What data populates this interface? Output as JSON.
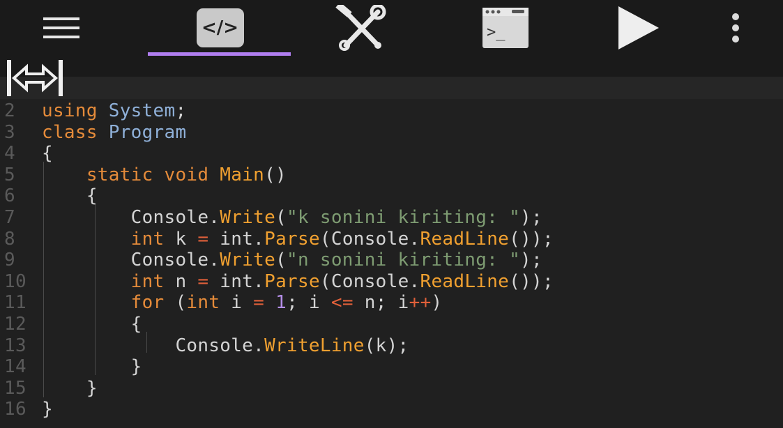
{
  "toolbar": {
    "menu_icon": "hamburger-menu-icon",
    "code_tab_label": "</>",
    "tools_icon": "wrench-hammer-icon",
    "terminal_icon": "terminal-icon",
    "terminal_prompt": ">_",
    "run_icon": "play-icon",
    "more_icon": "more-vertical-icon"
  },
  "editor": {
    "resize_icon": "resize-horizontal-icon",
    "lines": [
      {
        "n": "2",
        "code": [
          {
            "t": "using ",
            "c": "kw"
          },
          {
            "t": "System",
            "c": "ty"
          },
          {
            "t": ";",
            "c": ""
          }
        ]
      },
      {
        "n": "3",
        "code": [
          {
            "t": "class ",
            "c": "kw"
          },
          {
            "t": "Program",
            "c": "ty"
          }
        ]
      },
      {
        "n": "4",
        "code": [
          {
            "t": "{",
            "c": ""
          }
        ]
      },
      {
        "n": "5",
        "code": [
          {
            "t": "    static void ",
            "c": "kw"
          },
          {
            "t": "Main",
            "c": "fn"
          },
          {
            "t": "()",
            "c": ""
          }
        ]
      },
      {
        "n": "6",
        "code": [
          {
            "t": "    {",
            "c": ""
          }
        ]
      },
      {
        "n": "7",
        "code": [
          {
            "t": "        Console.",
            "c": ""
          },
          {
            "t": "Write",
            "c": "fn"
          },
          {
            "t": "(",
            "c": ""
          },
          {
            "t": "\"k sonini kiriting: \"",
            "c": "str"
          },
          {
            "t": ");",
            "c": ""
          }
        ]
      },
      {
        "n": "8",
        "code": [
          {
            "t": "        int ",
            "c": "kw"
          },
          {
            "t": "k ",
            "c": ""
          },
          {
            "t": "=",
            "c": "op"
          },
          {
            "t": " int.",
            "c": ""
          },
          {
            "t": "Parse",
            "c": "fn"
          },
          {
            "t": "(Console.",
            "c": ""
          },
          {
            "t": "ReadLine",
            "c": "fn"
          },
          {
            "t": "());",
            "c": ""
          }
        ]
      },
      {
        "n": "9",
        "code": [
          {
            "t": "        Console.",
            "c": ""
          },
          {
            "t": "Write",
            "c": "fn"
          },
          {
            "t": "(",
            "c": ""
          },
          {
            "t": "\"n sonini kiriting: \"",
            "c": "str"
          },
          {
            "t": ");",
            "c": ""
          }
        ]
      },
      {
        "n": "10",
        "code": [
          {
            "t": "        int ",
            "c": "kw"
          },
          {
            "t": "n ",
            "c": ""
          },
          {
            "t": "=",
            "c": "op"
          },
          {
            "t": " int.",
            "c": ""
          },
          {
            "t": "Parse",
            "c": "fn"
          },
          {
            "t": "(Console.",
            "c": ""
          },
          {
            "t": "ReadLine",
            "c": "fn"
          },
          {
            "t": "());",
            "c": ""
          }
        ]
      },
      {
        "n": "11",
        "code": [
          {
            "t": "        for ",
            "c": "kw"
          },
          {
            "t": "(",
            "c": ""
          },
          {
            "t": "int ",
            "c": "kw"
          },
          {
            "t": "i ",
            "c": ""
          },
          {
            "t": "=",
            "c": "op"
          },
          {
            "t": " ",
            "c": ""
          },
          {
            "t": "1",
            "c": "num"
          },
          {
            "t": "; i ",
            "c": ""
          },
          {
            "t": "<=",
            "c": "op"
          },
          {
            "t": " n; i",
            "c": ""
          },
          {
            "t": "++",
            "c": "op"
          },
          {
            "t": ")",
            "c": ""
          }
        ]
      },
      {
        "n": "12",
        "code": [
          {
            "t": "        {",
            "c": ""
          }
        ]
      },
      {
        "n": "13",
        "code": [
          {
            "t": "            Console.",
            "c": ""
          },
          {
            "t": "WriteLine",
            "c": "fn"
          },
          {
            "t": "(k);",
            "c": ""
          }
        ]
      },
      {
        "n": "14",
        "code": [
          {
            "t": "        }",
            "c": ""
          }
        ]
      },
      {
        "n": "15",
        "code": [
          {
            "t": "    }",
            "c": ""
          }
        ]
      },
      {
        "n": "16",
        "code": [
          {
            "t": "}",
            "c": ""
          }
        ]
      }
    ]
  }
}
